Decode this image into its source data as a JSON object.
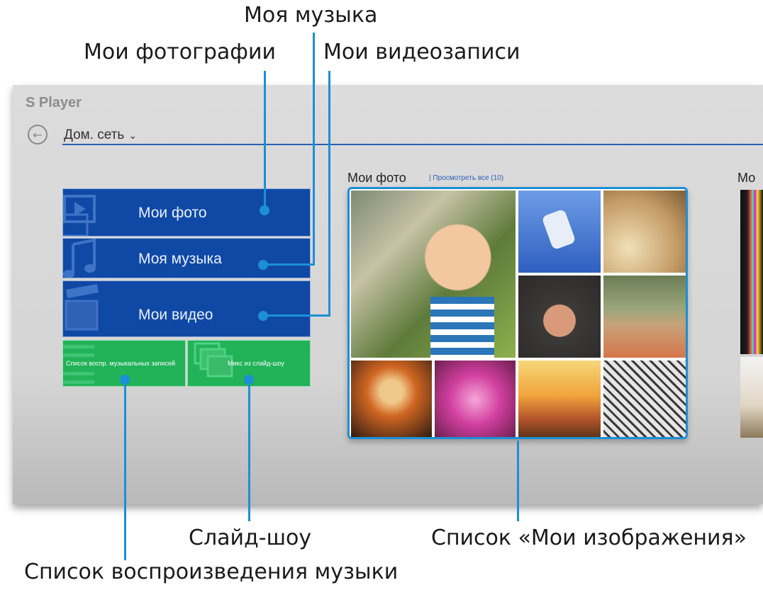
{
  "callouts": {
    "my_music": "Моя музыка",
    "my_photos": "Мои фотографии",
    "my_videos": "Мои видеозаписи",
    "slideshow": "Слайд-шоу",
    "my_images_list": "Список «Мои изображения»",
    "music_playlist": "Список воспроизведения музыки"
  },
  "app": {
    "title": "S Player",
    "location": "Дом. сеть"
  },
  "tiles": {
    "photos": "Мои фото",
    "music": "Моя музыка",
    "videos": "Мои видео",
    "playlist": "Список воспр. музыкальных записей",
    "slideshow": "Микс из слайд-шоу"
  },
  "section": {
    "title": "Мои фото",
    "view_all": "| Просмотреть все (10)",
    "next_title": "Мо"
  },
  "colors": {
    "accent": "#1c8fd6",
    "tile_blue": "#1049a5",
    "tile_green": "#22b258"
  },
  "icons": [
    "back-arrow-icon",
    "chevron-down-icon",
    "photo-icon",
    "music-note-icon",
    "video-clapper-icon"
  ]
}
